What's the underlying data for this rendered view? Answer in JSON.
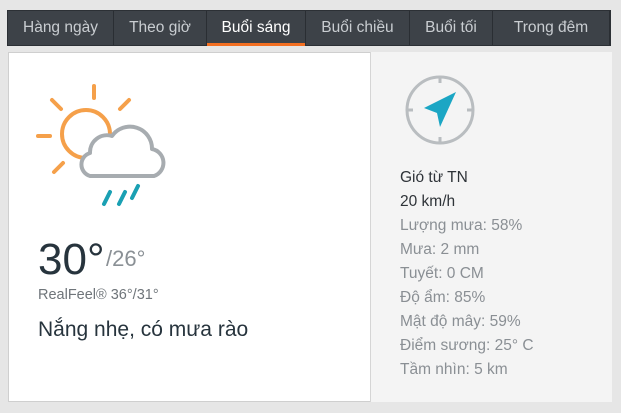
{
  "tabs": [
    {
      "label": "Hàng ngày",
      "active": false
    },
    {
      "label": "Theo giờ",
      "active": false
    },
    {
      "label": "Buổi sáng",
      "active": true
    },
    {
      "label": "Buổi chiều",
      "active": false
    },
    {
      "label": "Buổi tối",
      "active": false
    },
    {
      "label": "Trong đêm",
      "active": false
    }
  ],
  "forecast": {
    "icon": "sun-cloud-showers-icon",
    "temp": "30°",
    "temp_low": "/26°",
    "realfeel": "RealFeel® 36°/31°",
    "phrase": "Nắng nhẹ, có mưa rào"
  },
  "details": {
    "compass_icon": "compass-arrow-icon",
    "wind_dir": "Gió từ TN",
    "wind_speed": "20 km/h",
    "rain_prob": "Lượng mưa: 58%",
    "rain": "Mưa: 2 mm",
    "snow": "Tuyết: 0 CM",
    "humidity": "Độ ẩm: 85%",
    "cloud": "Mật độ mây: 59%",
    "dew_point": "Điểm sương: 25° C",
    "visibility": "Tầm nhìn: 5 km"
  },
  "colors": {
    "tab_bar": "#3d4248",
    "accent_orange": "#f36f21",
    "sun": "#f5a04a",
    "cloud": "#a7acb0",
    "rain": "#1aa0b3",
    "compass_arrow": "#1ba6c4"
  }
}
